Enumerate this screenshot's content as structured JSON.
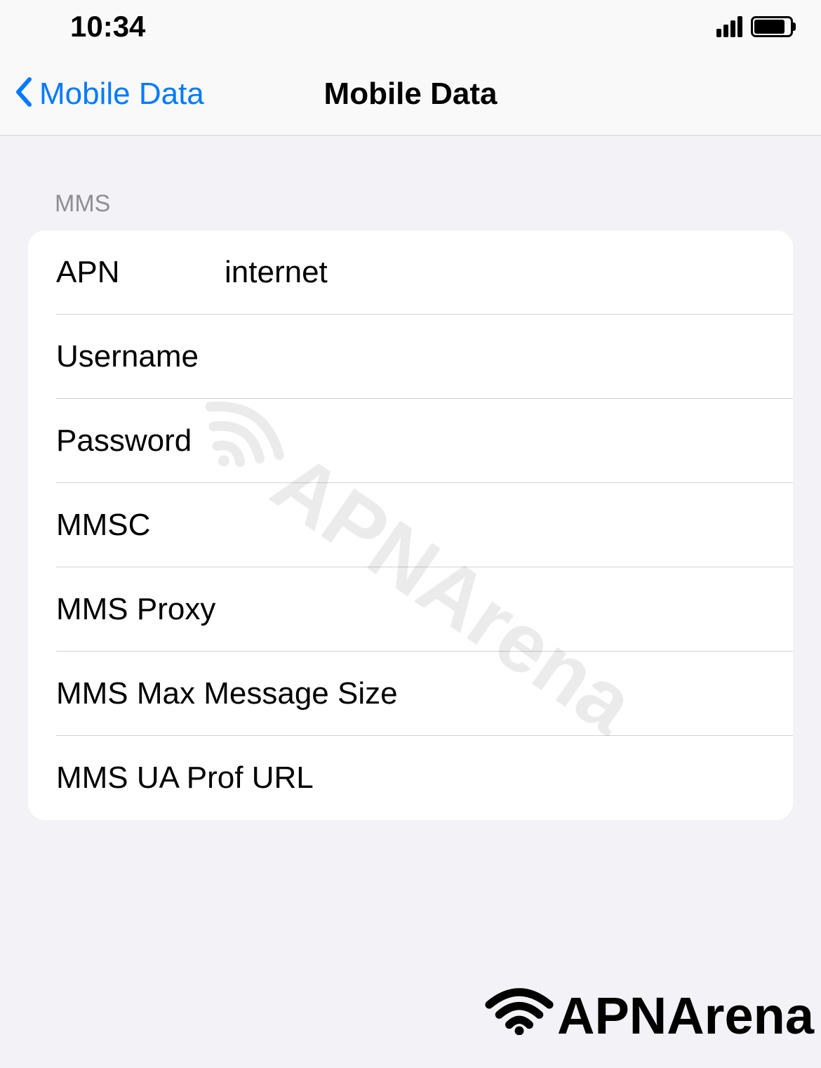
{
  "status_bar": {
    "time": "10:34"
  },
  "nav": {
    "back_label": "Mobile Data",
    "title": "Mobile Data"
  },
  "section": {
    "header": "MMS",
    "rows": [
      {
        "label": "APN",
        "value": "internet"
      },
      {
        "label": "Username",
        "value": ""
      },
      {
        "label": "Password",
        "value": ""
      },
      {
        "label": "MMSC",
        "value": ""
      },
      {
        "label": "MMS Proxy",
        "value": ""
      },
      {
        "label": "MMS Max Message Size",
        "value": ""
      },
      {
        "label": "MMS UA Prof URL",
        "value": ""
      }
    ]
  },
  "watermark": "APNArena",
  "logo": "APNArena"
}
